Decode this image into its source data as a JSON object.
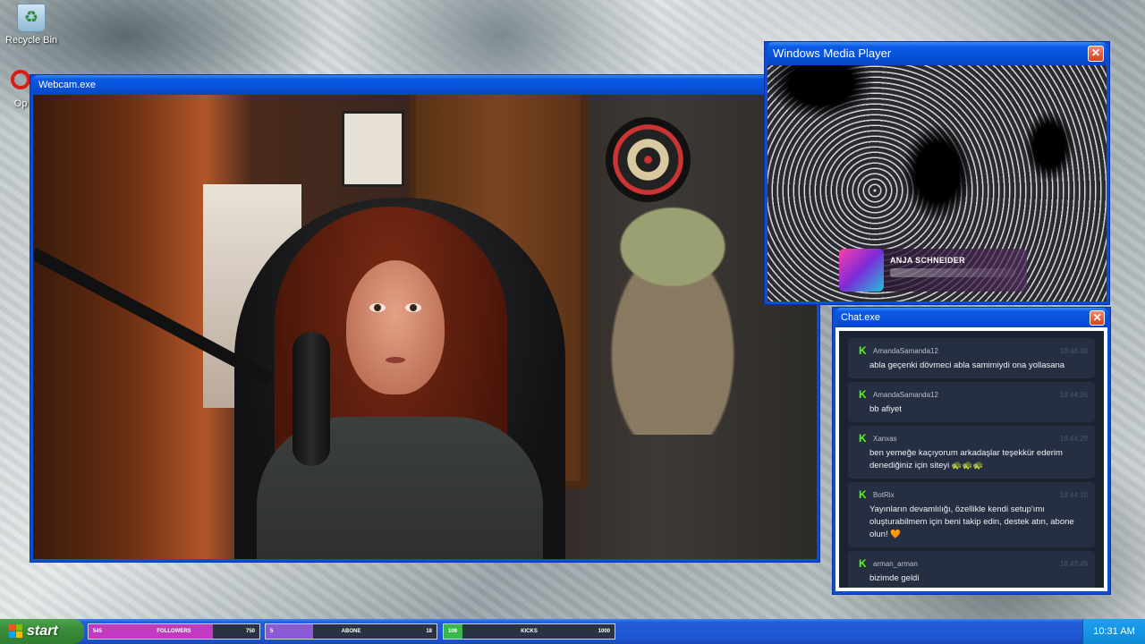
{
  "desktop": {
    "recycle_bin_label": "Recycle Bin",
    "opera_label": "Op"
  },
  "webcam_window": {
    "title": "Webcam.exe",
    "close_glyph": ""
  },
  "media_player": {
    "title": "Windows Media Player",
    "close_glyph": "✕",
    "now_playing_artist": "ANJA SCHNEIDER"
  },
  "chat_window": {
    "title": "Chat.exe",
    "close_glyph": "✕",
    "messages": [
      {
        "user": "AmandaSamanda12",
        "time": "18:46:40",
        "text": "abla geçenki dövmeci abla samimiydi ona yollasana"
      },
      {
        "user": "AmandaSamanda12",
        "time": "18:44:36",
        "text": "bb afiyet"
      },
      {
        "user": "Xanxas",
        "time": "18:44:28",
        "text": "ben yemeğe kaçıyorum arkadaşlar teşekkür ederim denediğiniz için siteyi 🐢🐢🐢"
      },
      {
        "user": "BotRix",
        "time": "18:44:10",
        "text": "Yayınların devamlılığı, özellikle kendi setup'ımı oluşturabilmem için beni takip edin, destek atın, abone olun! 🧡"
      },
      {
        "user": "arman_arman",
        "time": "18:43:49",
        "text": "bizimde geldi"
      }
    ]
  },
  "taskbar": {
    "start_label": "start",
    "clock": "10:31 AM",
    "goals": [
      {
        "current": "545",
        "label": "FOLLOWERS",
        "max": "750",
        "progress": 0.727,
        "color": "#c23ac2"
      },
      {
        "current": "5",
        "label": "ABONE",
        "max": "18",
        "progress": 0.28,
        "color": "#8a5ad8"
      },
      {
        "current": "109",
        "label": "KICKS",
        "max": "1000",
        "progress": 0.109,
        "color": "#3bb84a"
      }
    ]
  }
}
